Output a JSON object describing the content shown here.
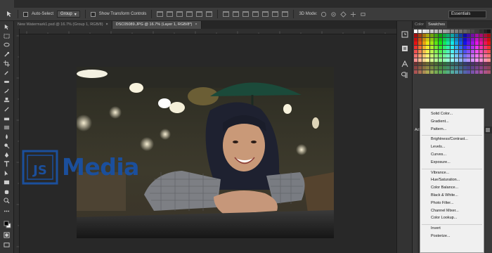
{
  "options_bar": {
    "auto_select_label": "Auto-Select",
    "auto_select_value": "Group",
    "show_transform_label": "Show Transform Controls",
    "mode_3d_label": "3D Mode:",
    "workspace": "Essentials"
  },
  "tabs": [
    {
      "label": "New Watermark1.psd @ 16.7% (Group 1, RGB/8)",
      "close": "×"
    },
    {
      "label": "DSC05089.JPG @ 16.7% (Layer 1, RGB/8*)",
      "close": "×"
    }
  ],
  "watermark": {
    "logo_text": "JS",
    "brand_text": "Media",
    "color": "#1b4f9c"
  },
  "panels": {
    "color_tab": "Color",
    "swatches_tab": "Swatches",
    "adjustments_tab": "Adjustments"
  },
  "adjustment_menu": {
    "items": [
      "Solid Color...",
      "Gradient...",
      "Pattern...",
      "Brightness/Contrast...",
      "Levels...",
      "Curves...",
      "Exposure...",
      "Vibrance...",
      "Hue/Saturation...",
      "Color Balance...",
      "Black & White...",
      "Photo Filter...",
      "Channel Mixer...",
      "Color Lookup...",
      "Invert",
      "Posterize..."
    ]
  },
  "colors": {
    "app_bg": "#2b2b2b",
    "canvas_bg": "#282828",
    "menu_bg": "#f0f0f0",
    "active_tab": "#4a4a4a"
  }
}
